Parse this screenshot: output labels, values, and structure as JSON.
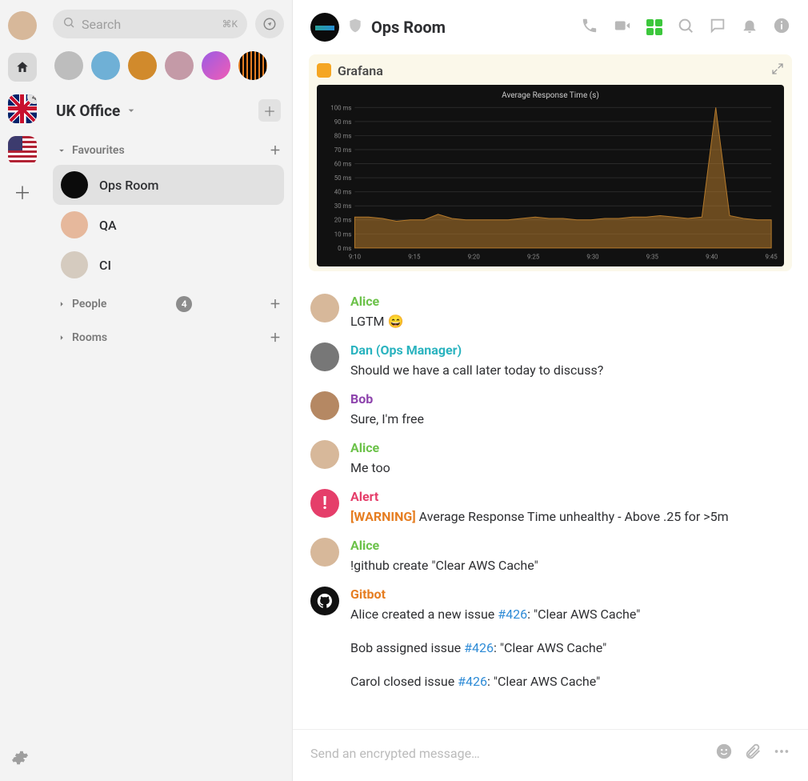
{
  "rail": {
    "home_badge": "",
    "uk_badge": "4"
  },
  "search": {
    "placeholder": "Search",
    "shortcut": "⌘K"
  },
  "space": {
    "name": "UK Office"
  },
  "sections": {
    "favourites": {
      "label": "Favourites"
    },
    "people": {
      "label": "People",
      "count": "4"
    },
    "rooms": {
      "label": "Rooms"
    }
  },
  "rooms": {
    "ops": "Ops Room",
    "qa": "QA",
    "ci": "CI"
  },
  "header": {
    "room": "Ops Room"
  },
  "embed": {
    "source": "Grafana"
  },
  "chart_data": {
    "type": "area",
    "title": "Average Response Time (s)",
    "x": [
      "9:10",
      "9:15",
      "9:20",
      "9:25",
      "9:30",
      "9:35",
      "9:40",
      "9:45"
    ],
    "y_ticks": [
      "0 ms",
      "10 ms",
      "20 ms",
      "30 ms",
      "40 ms",
      "50 ms",
      "60 ms",
      "70 ms",
      "80 ms",
      "90 ms",
      "100 ms"
    ],
    "ylim": [
      0,
      100
    ],
    "series": [
      {
        "name": "Average Response Time",
        "color": "#b57a2b",
        "values": [
          22,
          22,
          21,
          19,
          20,
          20,
          24,
          21,
          20,
          20,
          20,
          20,
          21,
          22,
          21,
          21,
          20,
          20,
          21,
          21,
          22,
          22,
          23,
          22,
          21,
          22,
          100,
          23,
          21,
          20,
          20
        ]
      }
    ],
    "spike_index": 26
  },
  "messages": [
    {
      "sender": "Alice",
      "color": "c-alice",
      "avatar": "av-alice",
      "text": "LGTM 😄"
    },
    {
      "sender": "Dan (Ops Manager)",
      "color": "c-dan",
      "avatar": "av-dan",
      "text": "Should we have a call later today to discuss?"
    },
    {
      "sender": "Bob",
      "color": "c-bob",
      "avatar": "av-bob",
      "text": "Sure, I'm free"
    },
    {
      "sender": "Alice",
      "color": "c-alice",
      "avatar": "av-alice",
      "text": "Me too"
    },
    {
      "sender": "Alert",
      "color": "c-alert",
      "avatar": "av-alert",
      "warning_tag": "[WARNING]",
      "text": "Average Response Time unhealthy - Above .25 for >5m"
    },
    {
      "sender": "Alice",
      "color": "c-alice",
      "avatar": "av-alice",
      "text": "!github create \"Clear AWS Cache\""
    },
    {
      "sender": "Gitbot",
      "color": "c-gitbot",
      "avatar": "av-git",
      "gitbot": true,
      "lines": [
        {
          "pre": "Alice created a new issue ",
          "issue": "#426",
          "post": ": \"Clear AWS Cache\""
        },
        {
          "pre": "Bob assigned issue ",
          "issue": "#426",
          "post": ": \"Clear AWS Cache\""
        },
        {
          "pre": "Carol closed issue ",
          "issue": "#426",
          "post": ": \"Clear AWS Cache\""
        }
      ]
    }
  ],
  "composer": {
    "placeholder": "Send an encrypted message…"
  }
}
